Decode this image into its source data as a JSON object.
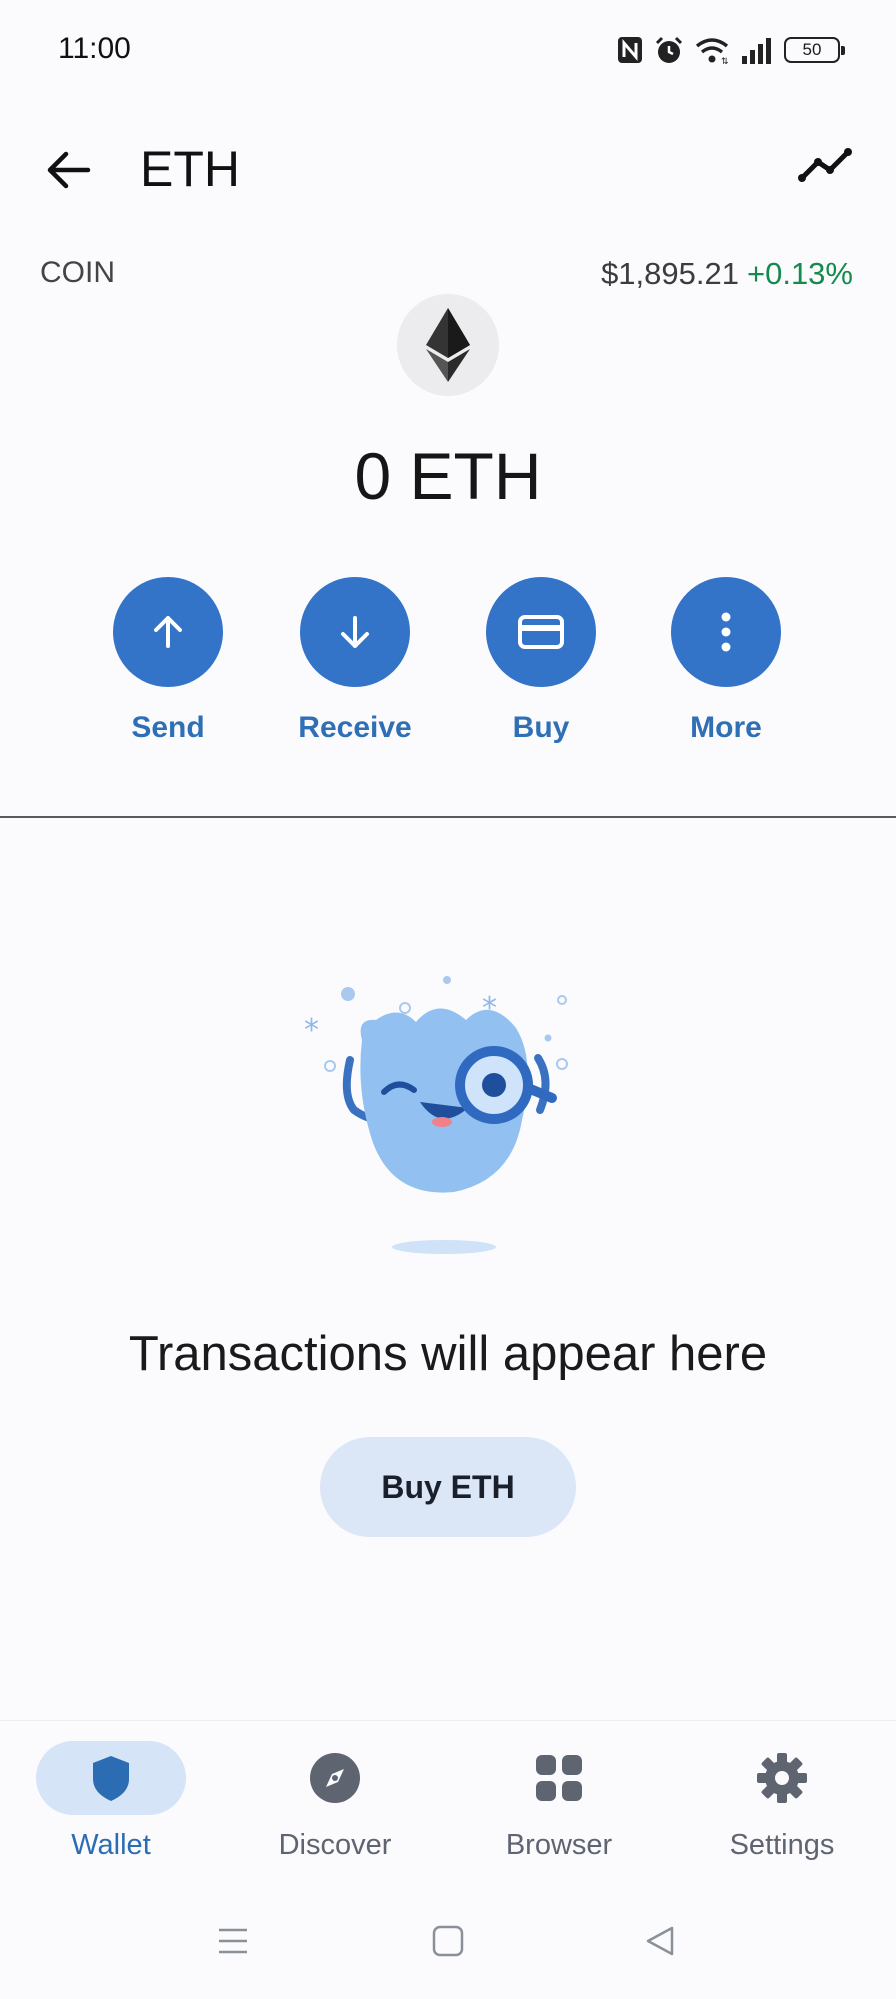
{
  "status_bar": {
    "time": "11:00",
    "battery": "50"
  },
  "app_bar": {
    "title": "ETH"
  },
  "coin": {
    "label": "COIN",
    "price": "$1,895.21",
    "change": "+0.13%",
    "balance": "0 ETH"
  },
  "actions": [
    {
      "label": "Send",
      "icon": "arrow-up-icon"
    },
    {
      "label": "Receive",
      "icon": "arrow-down-icon"
    },
    {
      "label": "Buy",
      "icon": "card-icon"
    },
    {
      "label": "More",
      "icon": "more-vertical-icon"
    }
  ],
  "empty_state": {
    "message": "Transactions will appear here",
    "button": "Buy ETH"
  },
  "bottom_nav": [
    {
      "label": "Wallet",
      "icon": "shield-icon",
      "active": true
    },
    {
      "label": "Discover",
      "icon": "compass-icon",
      "active": false
    },
    {
      "label": "Browser",
      "icon": "grid-icon",
      "active": false
    },
    {
      "label": "Settings",
      "icon": "gear-icon",
      "active": false
    }
  ],
  "colors": {
    "primary": "#3474c8",
    "positive": "#148a4d",
    "nav_active": "#2b6cb3",
    "nav_active_bg": "#d6e4f7",
    "button_bg": "#dbe6f7"
  }
}
